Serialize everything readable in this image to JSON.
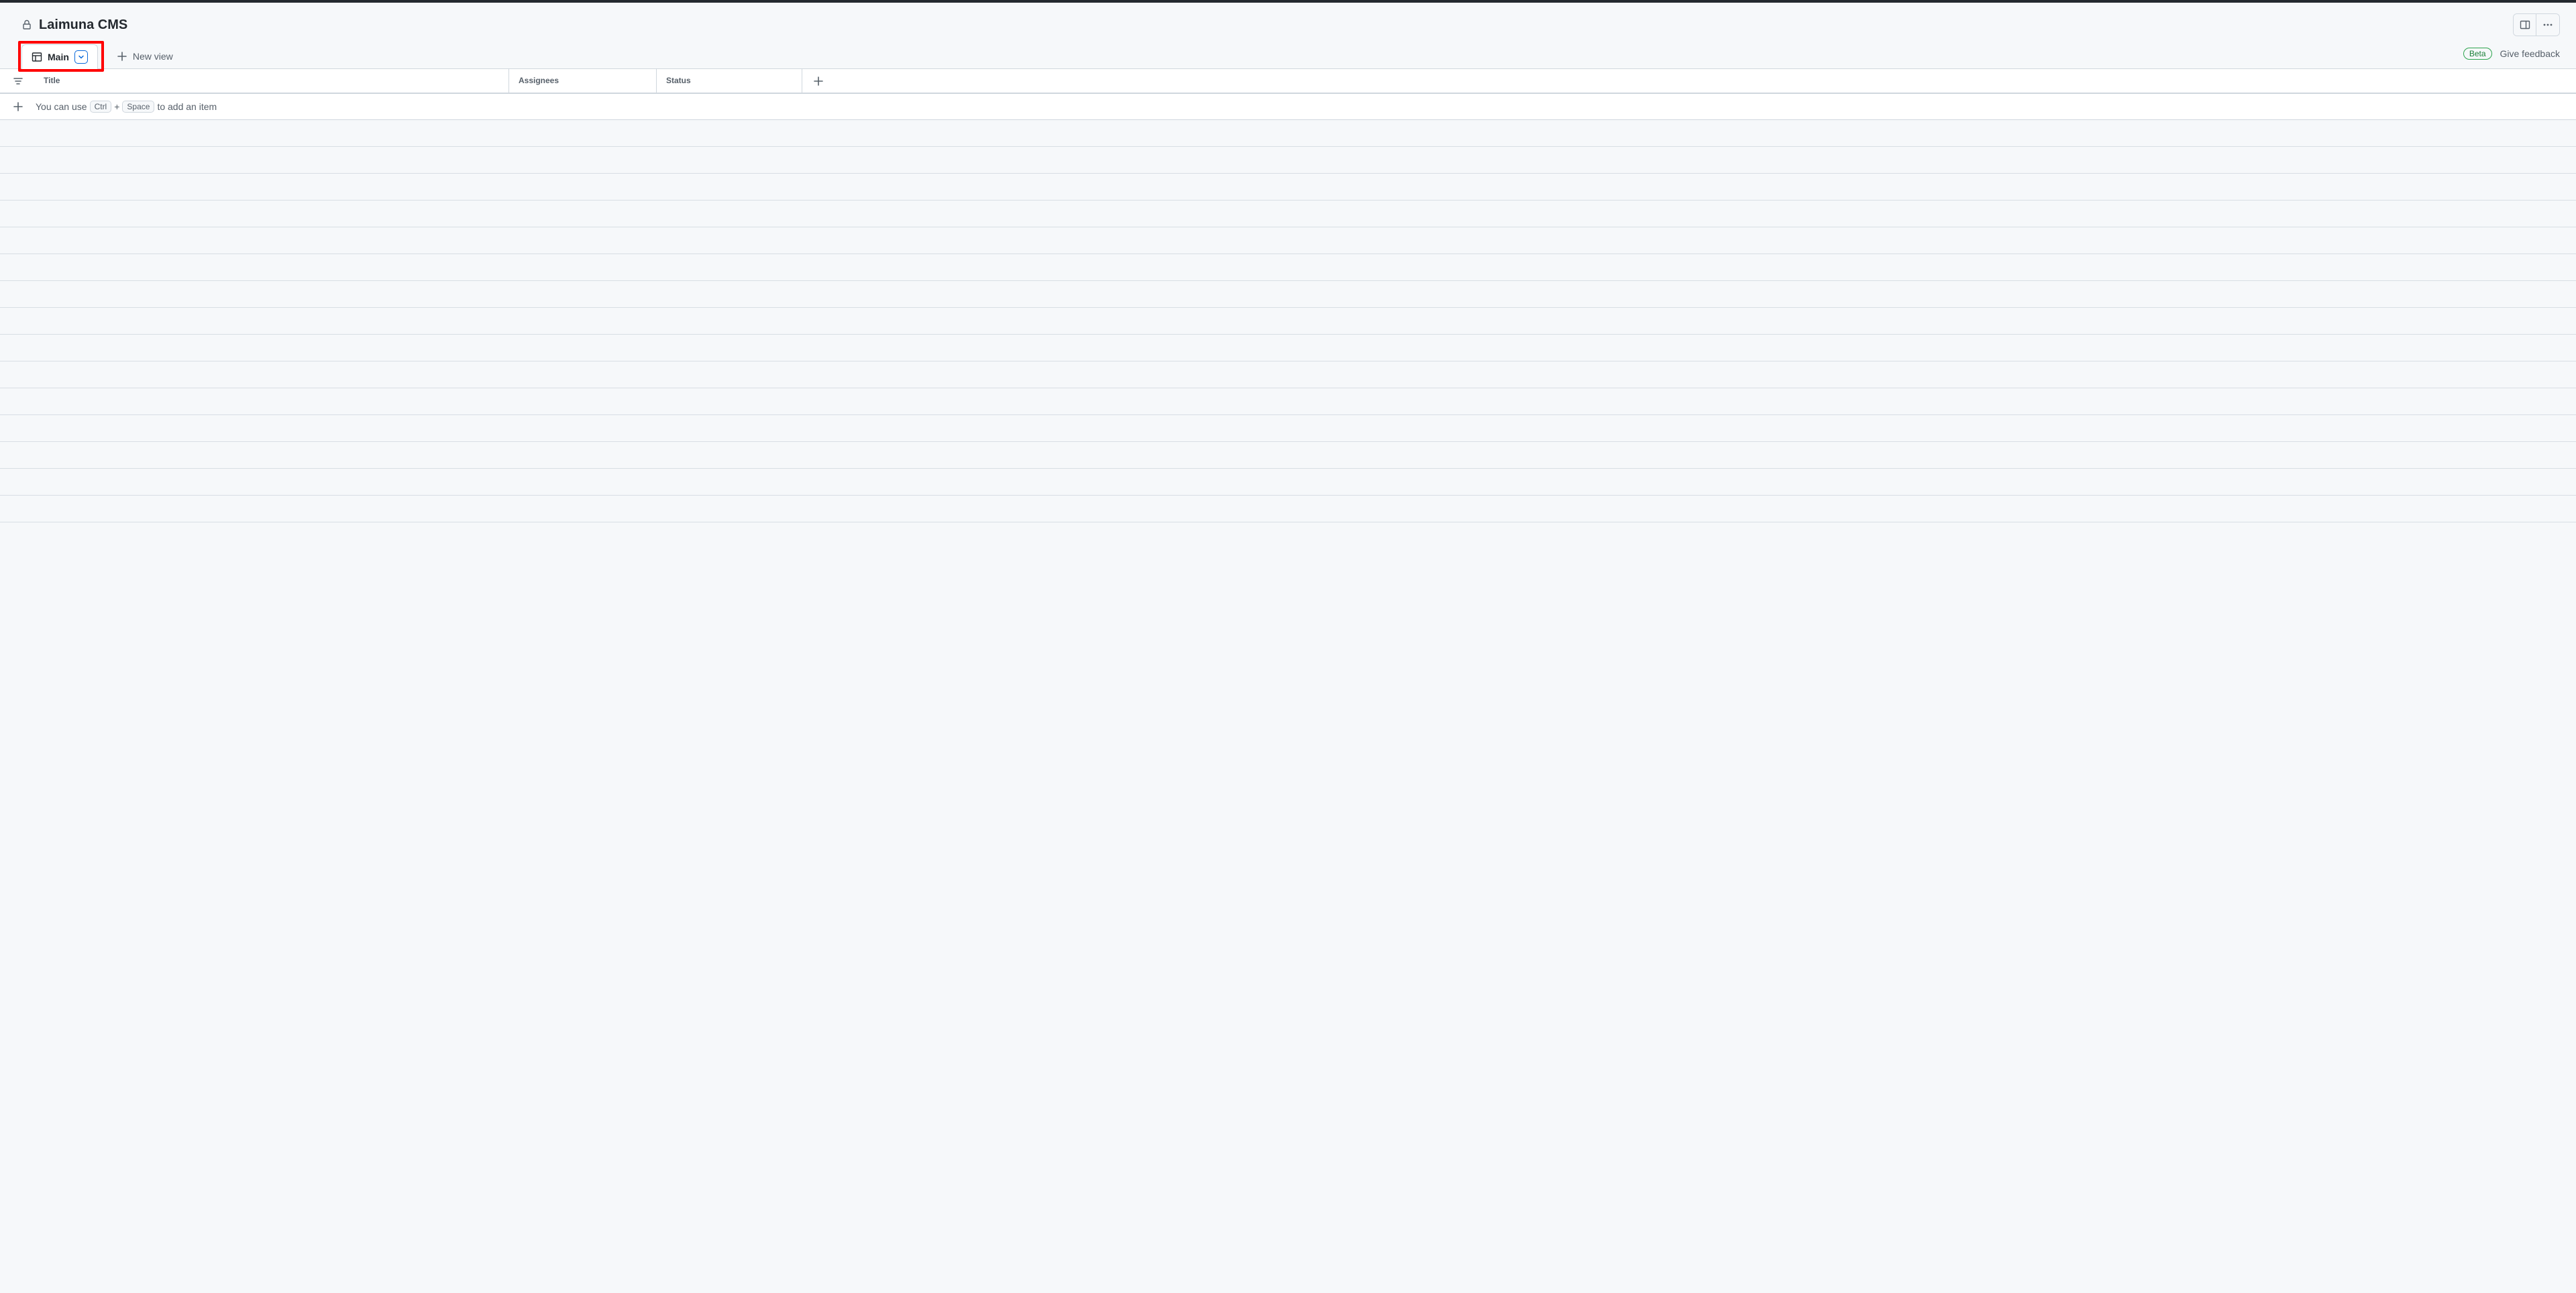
{
  "header": {
    "title": "Laimuna CMS"
  },
  "tabs": {
    "active": {
      "label": "Main"
    },
    "new_view_label": "New view"
  },
  "feedback": {
    "badge": "Beta",
    "link": "Give feedback"
  },
  "columns": {
    "title": "Title",
    "assignees": "Assignees",
    "status": "Status"
  },
  "add_row": {
    "text_before": "You can use",
    "key_ctrl": "Ctrl",
    "plus": "+",
    "key_space": "Space",
    "text_after": "to add an item"
  }
}
